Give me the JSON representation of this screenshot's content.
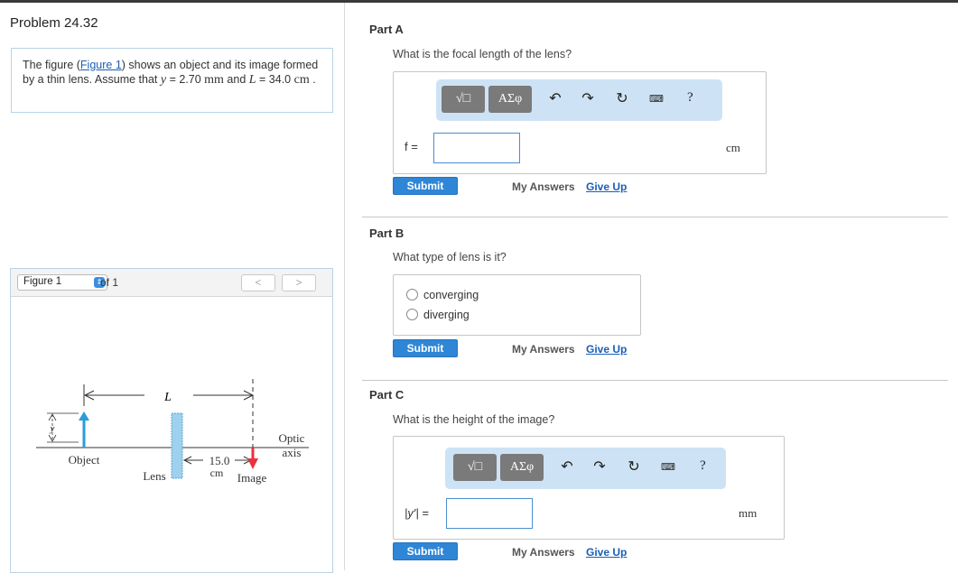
{
  "problem": {
    "title": "Problem 24.32",
    "statement_pre": "The figure (",
    "figure_link": "Figure 1",
    "statement_mid": ") shows an object and its image formed by a thin lens. Assume that ",
    "y_var": "y",
    "y_eq": " = 2.70 ",
    "y_unit": "mm",
    "and": " and ",
    "L_var": "L",
    "L_eq": " = 34.0 ",
    "L_unit": "cm",
    "period": " ."
  },
  "figure": {
    "selector_label": "Figure 1",
    "of_label": "of 1",
    "prev": "<",
    "next": ">",
    "labels": {
      "L": "L",
      "y": "y",
      "object": "Object",
      "lens": "Lens",
      "distance": "15.0",
      "distance_unit": "cm",
      "image": "Image",
      "optic": "Optic",
      "axis": "axis"
    },
    "colors": {
      "object_arrow": "#2a9bdc",
      "image_arrow": "#e8323c",
      "lens": "#9fd0ee"
    }
  },
  "parts": [
    {
      "label": "Part A",
      "question": "What is the focal length of the lens?",
      "toolbar": {
        "templates": "√□",
        "symbols": "ΑΣφ",
        "help": "?",
        "icons": [
          "undo-icon",
          "redo-icon",
          "reset-icon",
          "keyboard-icon"
        ]
      },
      "var_label": "f =",
      "unit": "cm",
      "submit": "Submit",
      "my_answers": "My Answers",
      "give_up": "Give Up"
    },
    {
      "label": "Part B",
      "question": "What type of lens is it?",
      "options": [
        "converging",
        "diverging"
      ],
      "submit": "Submit",
      "my_answers": "My Answers",
      "give_up": "Give Up"
    },
    {
      "label": "Part C",
      "question": "What is the height of the image?",
      "toolbar": {
        "templates": "√□",
        "symbols": "ΑΣφ",
        "help": "?",
        "icons": [
          "undo-icon",
          "redo-icon",
          "reset-icon",
          "keyboard-icon"
        ]
      },
      "var_label": "|y′| =",
      "unit": "mm",
      "submit": "Submit",
      "my_answers": "My Answers",
      "give_up": "Give Up"
    }
  ]
}
